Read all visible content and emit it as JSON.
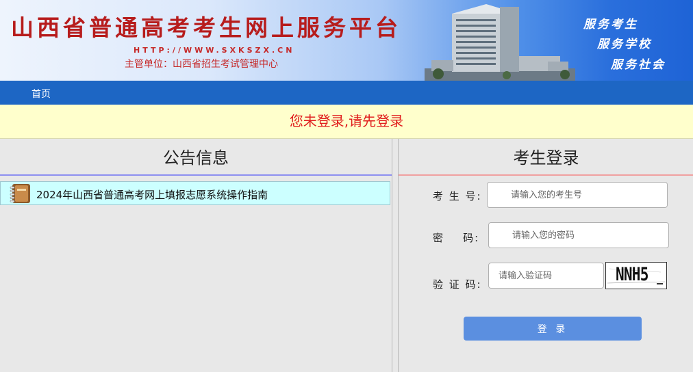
{
  "header": {
    "site_title": "山西省普通高考考生网上服务平台",
    "site_url": "HTTP://WWW.SXKSZX.CN",
    "org": "主管单位：山西省招生考试管理中心",
    "slogans": [
      "服务考生",
      "服务学校",
      "服务社会"
    ]
  },
  "nav": {
    "home": "首页"
  },
  "notice": {
    "message": "您未登录,请先登录"
  },
  "announcements": {
    "title": "公告信息",
    "items": [
      {
        "label": "2024年山西省普通高考网上填报志愿系统操作指南",
        "icon": "notebook-icon"
      }
    ]
  },
  "login": {
    "title": "考生登录",
    "candidate_label": "考 生 号:",
    "candidate_placeholder": "请输入您的考生号",
    "password_label": "密    码:",
    "password_placeholder": "请输入您的密码",
    "captcha_label": "验 证 码:",
    "captcha_placeholder": "请输入验证码",
    "captcha_text": "NNH5",
    "submit": "登 录"
  },
  "colors": {
    "nav_bar": "#1d66c4",
    "notice_bg": "#ffffcc",
    "notice_text": "#e01b1b",
    "title_red": "#b71c1c",
    "button": "#5b8fe0",
    "announcement_bg": "#ccffff"
  }
}
